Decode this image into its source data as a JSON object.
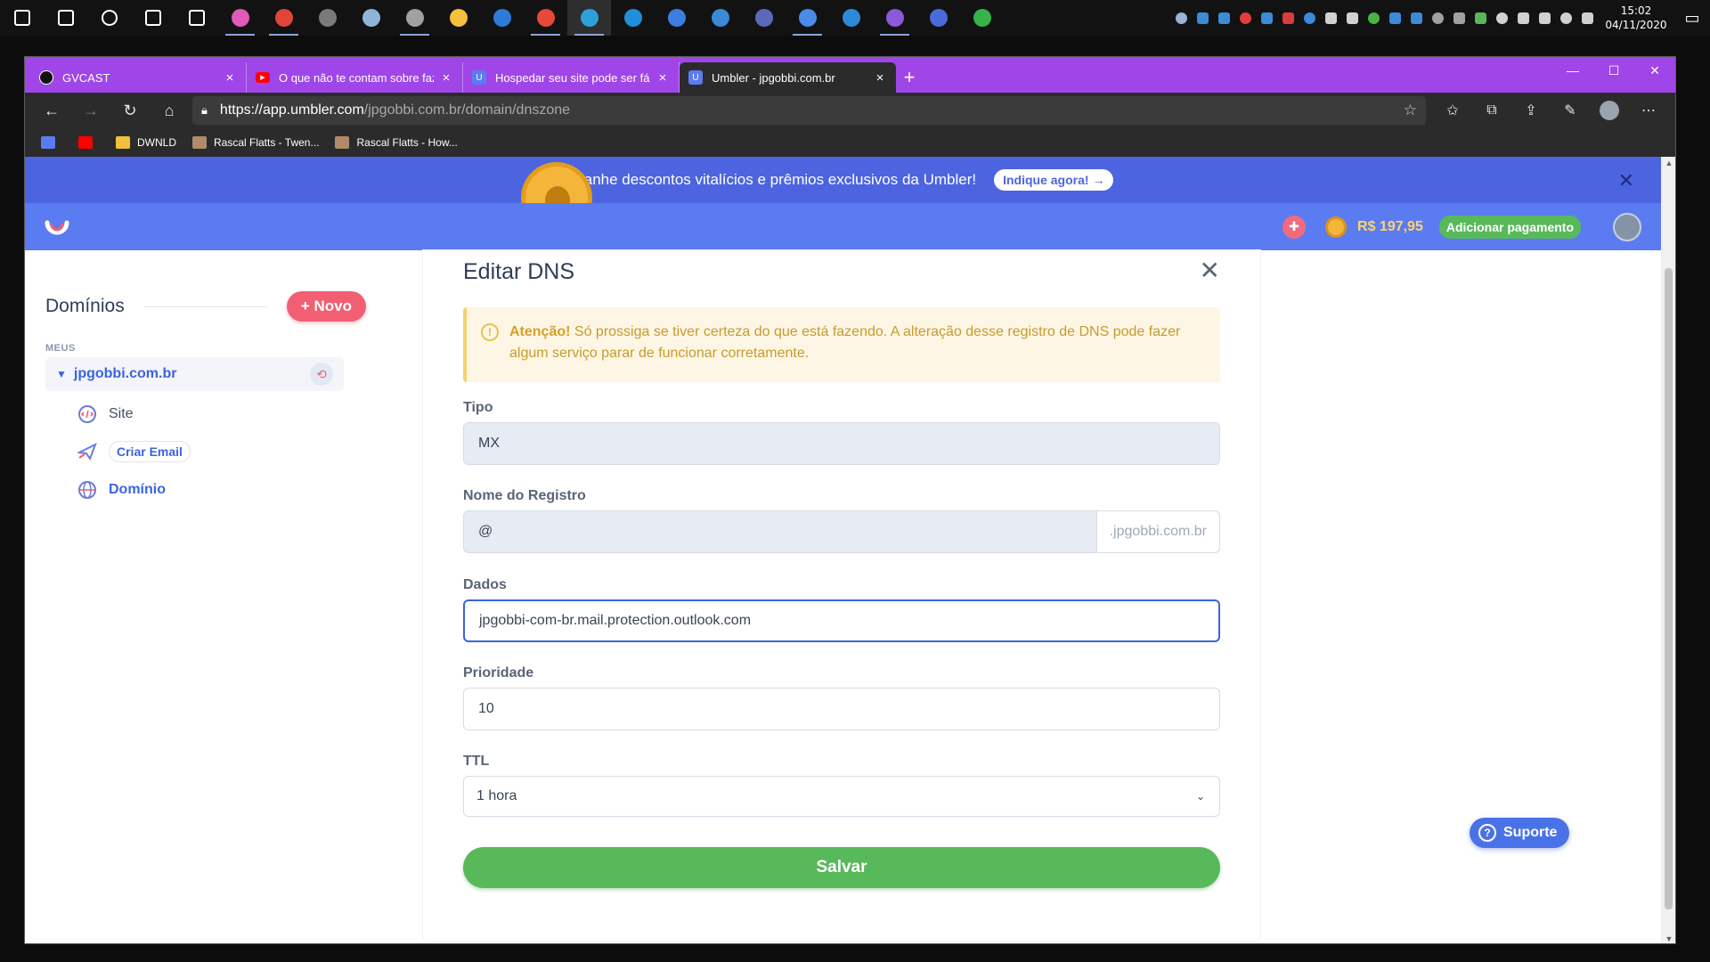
{
  "taskbar": {
    "apps": [
      {
        "icon": "windows-start-icon",
        "color": "#ffffff",
        "running": false
      },
      {
        "icon": "search-icon",
        "color": "#ffffff",
        "running": false
      },
      {
        "icon": "cortana-icon",
        "color": "#ffffff",
        "running": false
      },
      {
        "icon": "task-view-icon",
        "color": "#ffffff",
        "running": false
      },
      {
        "icon": "settings-gear-icon",
        "color": "#ffffff",
        "running": false
      },
      {
        "icon": "color-drop-icon",
        "color": "#e05ab8",
        "running": true
      },
      {
        "icon": "paint-tool-icon",
        "color": "#e0443a",
        "running": true
      },
      {
        "icon": "calculator-icon",
        "color": "#7a7a7a",
        "running": false
      },
      {
        "icon": "notes-icon",
        "color": "#8fb4d8",
        "running": false
      },
      {
        "icon": "photos-icon",
        "color": "#a0a0a0",
        "running": true
      },
      {
        "icon": "file-explorer-icon",
        "color": "#f3c03c",
        "running": false
      },
      {
        "icon": "settings-app-icon",
        "color": "#2d7bd8",
        "running": false
      },
      {
        "icon": "chrome-icon",
        "color": "#e6483a",
        "running": true
      },
      {
        "icon": "edge-icon",
        "color": "#2ea0d8",
        "running": true
      },
      {
        "icon": "skype-icon",
        "color": "#1e8fd8",
        "running": false
      },
      {
        "icon": "todo-icon",
        "color": "#3c7ee0",
        "running": false
      },
      {
        "icon": "remote-desktop-icon",
        "color": "#3a8ad8",
        "running": false
      },
      {
        "icon": "vpn-icon",
        "color": "#5a6ab8",
        "running": false
      },
      {
        "icon": "messenger-icon",
        "color": "#4a8ae8",
        "running": true
      },
      {
        "icon": "vscode-icon",
        "color": "#2c8ad8",
        "running": false
      },
      {
        "icon": "twitch-icon",
        "color": "#8a5ad8",
        "running": true
      },
      {
        "icon": "network-app-icon",
        "color": "#4a6ad8",
        "running": false
      },
      {
        "icon": "whatsapp-icon",
        "color": "#34b44a",
        "running": false
      }
    ],
    "tray": [
      "#9ab2d8",
      "#3c8ad8",
      "#3c8ad8",
      "#e23c3c",
      "#3c8ad8",
      "#d83c3c",
      "#3c8ad8",
      "#d0d0d0",
      "#d0d0d0",
      "#48b448",
      "#3c8ad8",
      "#3c8ad8",
      "#a0a0a0",
      "#a0a0a0",
      "#58b858",
      "#d0d0d0",
      "#d0d0d0",
      "#d0d0d0",
      "#d0d0d0",
      "#d0d0d0"
    ],
    "time": "15:02",
    "date": "04/11/2020"
  },
  "browser": {
    "tabs": [
      {
        "title": "GVCAST",
        "favicon": "gvcast-icon",
        "fav_color": "#111111",
        "active": false
      },
      {
        "title": "O que não te contam sobre fazer",
        "favicon": "youtube-icon",
        "fav_color": "#ff0000",
        "active": false
      },
      {
        "title": "Hospedar seu site pode ser fácil",
        "favicon": "umbler-icon",
        "fav_color": "#ffffff",
        "active": false
      },
      {
        "title": "Umbler - jpgobbi.com.br",
        "favicon": "umbler-icon",
        "fav_color": "#ffffff",
        "active": true
      }
    ],
    "url_host": "https://app.umbler.com",
    "url_path": "/jpgobbi.com.br/domain/dnszone",
    "bookmarks": [
      {
        "label": "",
        "icon": "umbler-bookmark-icon",
        "color": "#5b7cf0"
      },
      {
        "label": "",
        "icon": "youtube-bookmark-icon",
        "color": "#ff0000"
      },
      {
        "label": "DWNLD",
        "icon": "folder-icon",
        "color": "#f3c03c"
      },
      {
        "label": "Rascal Flatts - Twen...",
        "icon": "bookmark-favicon-icon",
        "color": "#b08a6a"
      },
      {
        "label": "Rascal Flatts - How...",
        "icon": "bookmark-favicon-icon",
        "color": "#b08a6a"
      }
    ]
  },
  "banner": {
    "message": "Ganhe descontos vitalícios e prêmios exclusivos da Umbler!",
    "cta": "Indique agora!"
  },
  "header": {
    "balance": "R$ 197,95",
    "add_payment": "Adicionar pagamento"
  },
  "sidebar": {
    "title": "Domínios",
    "new_button": "Novo",
    "section": "MEUS",
    "domain": "jpgobbi.com.br",
    "items": [
      {
        "label": "Site"
      },
      {
        "label": "Criar Email"
      },
      {
        "label": "Domínio"
      }
    ]
  },
  "modal": {
    "title": "Editar DNS",
    "alert_strong": "Atenção!",
    "alert_text": " Só prossiga se tiver certeza do que está fazendo. A alteração desse registro de DNS pode fazer algum serviço parar de funcionar corretamente.",
    "fields": {
      "tipo_label": "Tipo",
      "tipo_value": "MX",
      "nome_label": "Nome do Registro",
      "nome_value": "@",
      "nome_suffix": ".jpgobbi.com.br",
      "dados_label": "Dados",
      "dados_value": "jpgobbi-com-br.mail.protection.outlook.com",
      "prioridade_label": "Prioridade",
      "prioridade_value": "10",
      "ttl_label": "TTL",
      "ttl_value": "1 hora"
    },
    "save": "Salvar"
  },
  "support": "Suporte",
  "colors": {
    "brand_blue": "#5b7cf0",
    "banner_blue": "#4d64e0",
    "accent_red": "#f25f72",
    "success_green": "#58b95a",
    "tab_purple": "#a046e8"
  }
}
